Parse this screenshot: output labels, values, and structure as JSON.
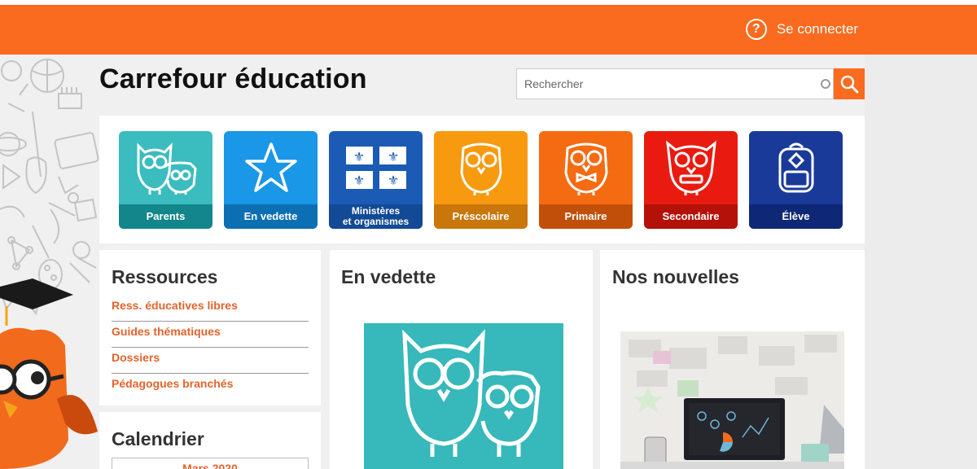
{
  "header": {
    "login_label": "Se connecter",
    "help_icon": "question-circle-icon"
  },
  "site": {
    "title": "Carrefour éducation"
  },
  "search": {
    "placeholder": "Rechercher",
    "icon": "search-icon"
  },
  "tiles": [
    {
      "label": "Parents",
      "color": "#3bbcbf",
      "band": "#12868a",
      "icon": "owl-pair-icon"
    },
    {
      "label": "En vedette",
      "color": "#1a97e6",
      "band": "#0d6fb3",
      "icon": "star-icon"
    },
    {
      "label_line1": "Ministères",
      "label_line2": "et organismes",
      "color": "#1b5bb5",
      "band": "#124a95",
      "icon": "quebec-flag-icon"
    },
    {
      "label": "Préscolaire",
      "color": "#f79a0f",
      "band": "#c9760a",
      "icon": "owl-baby-icon"
    },
    {
      "label": "Primaire",
      "color": "#f56b12",
      "band": "#c14f0a",
      "icon": "owl-bowtie-icon"
    },
    {
      "label": "Secondaire",
      "color": "#e91b10",
      "band": "#b31109",
      "icon": "owl-braces-icon"
    },
    {
      "label": "Élève",
      "color": "#1a3a9a",
      "band": "#0e2876",
      "icon": "backpack-icon"
    }
  ],
  "ressources": {
    "title": "Ressources",
    "links": [
      "Ress. éducatives libres",
      "Guides thématiques",
      "Dossiers",
      "Pédagogues branchés"
    ]
  },
  "calendrier": {
    "title": "Calendrier",
    "month": "Mars 2020"
  },
  "vedette": {
    "title": "En vedette"
  },
  "nouvelles": {
    "title": "Nos nouvelles"
  }
}
